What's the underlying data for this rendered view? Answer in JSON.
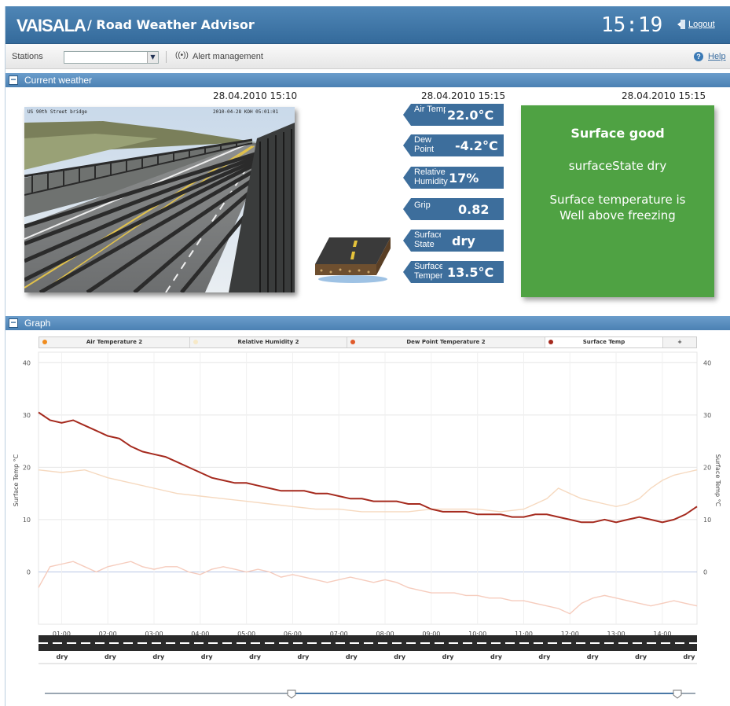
{
  "header": {
    "brand": "VAISALA",
    "app_title": "/ Road Weather Advisor",
    "clock": "15:19",
    "logout_label": "Logout",
    "bg_color": "#3f77a8"
  },
  "toolbar": {
    "stations_label": "Stations",
    "stations_value": "",
    "alert_label": "Alert management",
    "help_label": "Help"
  },
  "current_weather": {
    "section_title": "Current weather",
    "camera_timestamp": "28.04.2010 15:10",
    "camera_caption_left": "US 90th Street bridge",
    "camera_caption_right": "2010-04-28 KOH 05:01:01",
    "measurements_timestamp": "28.04.2010 15:15",
    "status_timestamp": "28.04.2010 15:15",
    "measurements": [
      {
        "label": "Air Temperat",
        "value": "22.0°C"
      },
      {
        "label": "Dew Point",
        "value": "-4.2°C"
      },
      {
        "label": "Relative Humidity",
        "value": "17%"
      },
      {
        "label": "Grip",
        "value": "0.82"
      },
      {
        "label": "Surface State",
        "value": "dry"
      },
      {
        "label": "Surface Temperat",
        "value": "13.5°C"
      }
    ],
    "status": {
      "headline": "Surface good",
      "state_text": "surfaceState dry",
      "temp_text_line1": "Surface temperature is",
      "temp_text_line2": "Well above freezing",
      "color": "#4fa243"
    }
  },
  "graph": {
    "section_title": "Graph",
    "tabs": [
      {
        "label": "Air Temperature 2",
        "color": "#f08c1e",
        "active": false
      },
      {
        "label": "Relative Humidity 2",
        "color": "#f7e9c8",
        "active": false
      },
      {
        "label": "Dew Point Temperature 2",
        "color": "#e05a2a",
        "active": false
      },
      {
        "label": "Surface Temp",
        "color": "#a52a1e",
        "active": true
      }
    ],
    "add_tab_label": "+",
    "surface_state_labels": [
      "dry",
      "dry",
      "dry",
      "dry",
      "dry",
      "dry",
      "dry",
      "dry",
      "dry",
      "dry",
      "dry",
      "dry",
      "dry",
      "dry"
    ]
  },
  "chart_data": {
    "type": "line",
    "ylabel": "Surface Temp °C",
    "ylabel_right": "Surface Temp °C",
    "ylim": [
      -10,
      42
    ],
    "yticks": [
      0,
      10,
      20,
      30,
      40
    ],
    "xlim": [
      0.5,
      14.75
    ],
    "xticks": [
      "01:00",
      "02:00",
      "03:00",
      "04:00",
      "05:00",
      "06:00",
      "07:00",
      "08:00",
      "09:00",
      "10:00",
      "11:00",
      "12:00",
      "13:00",
      "14:00"
    ],
    "grid": true,
    "series": [
      {
        "name": "Surface Temp",
        "color": "#a52a1e",
        "x": [
          0.5,
          0.75,
          1,
          1.25,
          1.5,
          1.75,
          2,
          2.25,
          2.5,
          2.75,
          3,
          3.25,
          3.5,
          3.75,
          4,
          4.25,
          4.5,
          4.75,
          5,
          5.25,
          5.5,
          5.75,
          6,
          6.25,
          6.5,
          6.75,
          7,
          7.25,
          7.5,
          7.75,
          8,
          8.25,
          8.5,
          8.75,
          9,
          9.25,
          9.5,
          9.75,
          10,
          10.25,
          10.5,
          10.75,
          11,
          11.25,
          11.5,
          11.75,
          12,
          12.25,
          12.5,
          12.75,
          13,
          13.25,
          13.5,
          13.75,
          14,
          14.25,
          14.5,
          14.75
        ],
        "y": [
          30.5,
          29,
          28.5,
          29,
          28,
          27,
          26,
          25.5,
          24,
          23,
          22.5,
          22,
          21,
          20,
          19,
          18,
          17.5,
          17,
          17,
          16.5,
          16,
          15.5,
          15.5,
          15.5,
          15,
          15,
          14.5,
          14,
          14,
          13.5,
          13.5,
          13.5,
          13,
          13,
          12,
          11.5,
          11.5,
          11.5,
          11,
          11,
          11,
          10.5,
          10.5,
          11,
          11,
          10.5,
          10,
          9.5,
          9.5,
          10,
          9.5,
          10,
          10.5,
          10,
          9.5,
          10,
          11,
          12.5
        ]
      },
      {
        "name": "Relative Humidity 2",
        "color": "#f6d9bf",
        "x": [
          0.5,
          1,
          1.5,
          2,
          2.5,
          3,
          3.5,
          4,
          4.5,
          5,
          5.5,
          6,
          6.5,
          7,
          7.5,
          8,
          8.5,
          9,
          9.5,
          10,
          10.5,
          11,
          11.25,
          11.5,
          11.75,
          12,
          12.25,
          12.5,
          12.75,
          13,
          13.25,
          13.5,
          13.75,
          14,
          14.25,
          14.5,
          14.75
        ],
        "y": [
          19.5,
          19,
          19.5,
          18,
          17,
          16,
          15,
          14.5,
          14,
          13.5,
          13,
          12.5,
          12,
          12,
          11.5,
          11.5,
          11.5,
          12,
          12,
          12,
          11.5,
          12,
          13,
          14,
          16,
          15,
          14,
          13.5,
          13,
          12.5,
          13,
          14,
          16,
          17.5,
          18.5,
          19,
          19.5
        ]
      },
      {
        "name": "Dew Point Temperature 2",
        "color": "#f6ccbd",
        "x": [
          0.5,
          0.75,
          1,
          1.25,
          1.5,
          1.75,
          2,
          2.25,
          2.5,
          2.75,
          3,
          3.25,
          3.5,
          3.75,
          4,
          4.25,
          4.5,
          4.75,
          5,
          5.25,
          5.5,
          5.75,
          6,
          6.25,
          6.5,
          6.75,
          7,
          7.25,
          7.5,
          7.75,
          8,
          8.25,
          8.5,
          8.75,
          9,
          9.25,
          9.5,
          9.75,
          10,
          10.25,
          10.5,
          10.75,
          11,
          11.25,
          11.5,
          11.75,
          12,
          12.25,
          12.5,
          12.75,
          13,
          13.25,
          13.5,
          13.75,
          14,
          14.25,
          14.5,
          14.75
        ],
        "y": [
          -3,
          1,
          1.5,
          2,
          1,
          0,
          1,
          1.5,
          2,
          1,
          0.5,
          1,
          1,
          0,
          -0.5,
          0.5,
          1,
          0.5,
          0,
          0.5,
          0,
          -1,
          -0.5,
          -1,
          -1.5,
          -2,
          -1.5,
          -1,
          -1.5,
          -2,
          -1.5,
          -2,
          -3,
          -3.5,
          -4,
          -4,
          -4,
          -4.5,
          -4.5,
          -5,
          -5,
          -5.5,
          -5.5,
          -6,
          -6.5,
          -7,
          -8,
          -6,
          -5,
          -4.5,
          -5,
          -5.5,
          -6,
          -6.5,
          -6,
          -5.5,
          -6,
          -6.5
        ]
      }
    ]
  }
}
